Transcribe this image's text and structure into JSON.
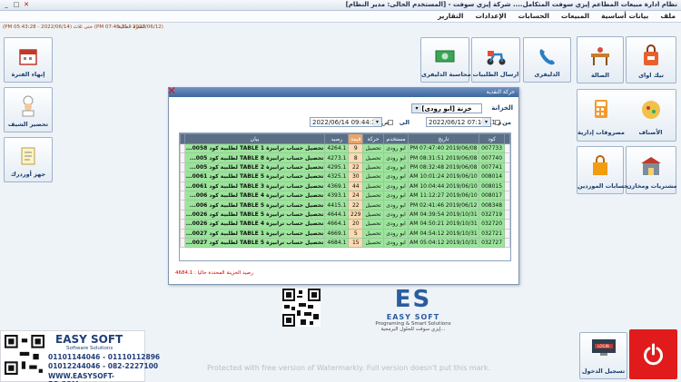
{
  "titlebar": {
    "title": "نظام ادارة مبيعات المطاعم إيزي سوفت المتكامل.... شركة إيزي سوفت - [المستخدم الحالى: مدير النظام]",
    "minimize": "_",
    "maximize": "□",
    "close": "✕"
  },
  "menu": [
    "ملف",
    "بيانات أساسية",
    "المبيعات",
    "الحسابات",
    "الإعدادات",
    "التقارير"
  ],
  "status": {
    "left": "(PM 05:43:28 - 2022/06/14) حتى ثلاث (PM 07:46:11 - 2022/06/12)",
    "right": "الفترة الحالية"
  },
  "tiles": {
    "takeaway": "تيك اواى",
    "hall": "الصالة",
    "delivery": "الدليفرى",
    "send_orders": "ارسال الطلبيات",
    "delivery_accounting": "محاسبة الدليفرى",
    "end_shift": "إنهاء الفترة",
    "prepare_chef": "تحضير الشيف",
    "prepare_order": "جهز أوردرك",
    "items": "الأصناف",
    "admin_expenses": "مصروفات إدارية",
    "purchases_stores": "مشتريات ومخازن",
    "supplier_accounts": "حسابات الموردين",
    "login": "تسجيل الدخول",
    "login_screen": "LOGIN"
  },
  "cash_window": {
    "title": "حركة النقدية",
    "close": "✕",
    "treasury_label": "الخزانة",
    "treasury_value": "خزنة [ابو رودى]",
    "dropdown_arrow": "▾",
    "from_label": "من",
    "to_label": "الى",
    "date_from": "2022/06/12  07:16:11 م",
    "date_to": "2022/06/14  09:44:30 ص",
    "columns": [
      "كود",
      "تاريخ",
      "مستخدم",
      "حركة",
      "قيمة",
      "رصيد",
      "بيان"
    ],
    "rows": [
      [
        "007733",
        "PM 07:47:40 2019/06/08",
        "ابو رودى",
        "تحصيل",
        "9",
        "4264.1",
        "تحصيل حساب ترابيزة 1 TABLE لطلبية كود 0058..."
      ],
      [
        "007740",
        "PM 08:31:51 2019/06/08",
        "ابو رودى",
        "تحصيل",
        "8",
        "4273.1",
        "تحصيل حساب ترابيزة 8 TABLE لطلبية كود 005..."
      ],
      [
        "007741",
        "PM 08:32:48 2019/06/08",
        "ابو رودى",
        "تحصيل",
        "22",
        "4295.1",
        "تحصيل حساب ترابيزة 2 TABLE لطلبية كود 005..."
      ],
      [
        "008014",
        "AM 10:01:24 2019/06/10",
        "ابو رودى",
        "تحصيل",
        "30",
        "4325.1",
        "تحصيل حساب ترابيزة 5 TABLE لطلبية كود 0061..."
      ],
      [
        "008015",
        "AM 10:04:44 2019/06/10",
        "ابو رودى",
        "تحصيل",
        "44",
        "4369.1",
        "تحصيل حساب ترابيزة 3 TABLE لطلبية كود 0061..."
      ],
      [
        "008017",
        "AM 11:12:27 2019/06/10",
        "ابو رودى",
        "تحصيل",
        "24",
        "4393.1",
        "تحصيل حساب ترابيزة 4 TABLE لطلبية كود 006..."
      ],
      [
        "008348",
        "PM 02:41:46 2019/06/12",
        "ابو رودى",
        "تحصيل",
        "22",
        "4415.1",
        "تحصيل حساب ترابيزة 5 TABLE لطلبية كود 006..."
      ],
      [
        "032719",
        "AM 04:39:54 2019/10/31",
        "ابو رودى",
        "تحصيل",
        "229",
        "4644.1",
        "تحصيل حساب ترابيزة 5 TABLE لطلبية كود 0026..."
      ],
      [
        "032720",
        "AM 04:50:21 2019/10/31",
        "ابو رودى",
        "تحصيل",
        "20",
        "4664.1",
        "تحصيل حساب ترابيزة 4 TABLE لطلبية كود 0026..."
      ],
      [
        "032721",
        "AM 04:54:12 2019/10/31",
        "ابو رودى",
        "تحصيل",
        "5",
        "4669.1",
        "تحصيل حساب ترابيزة 1 TABLE لطلبية كود 0027..."
      ],
      [
        "032727",
        "AM 05:04:12 2019/10/31",
        "ابو رودى",
        "تحصيل",
        "15",
        "4684.1",
        "تحصيل حساب ترابيزة 5 TABLE لطلبية كود 0027..."
      ]
    ],
    "footer": "رصيد الخزينة المحددة حاليا : 4684.1"
  },
  "logo_mid": {
    "mark": "ES",
    "brand": "EASY SOFT",
    "tagline": "Programing & Smart Solutions",
    "tagline_ar": "إيزي سوفت للحلول البرمجية..."
  },
  "watermark": "Protected with free version of Watermarkly. Full version doesn't put this mark.",
  "branding": {
    "name": "EASY SOFT",
    "tagline": "Software Solutions",
    "phone1_a": "01101144046",
    "phone1_b": "01110112896",
    "phone2_a": "01012244046",
    "phone2_b": "082-2227100",
    "web": "WWW.EASYSOFT-EG.COM"
  },
  "colors": {
    "row_green": "#9be59b",
    "header_dark": "#5a6e86",
    "power_red": "#e11b1b",
    "brand_blue": "#1f3f78"
  }
}
